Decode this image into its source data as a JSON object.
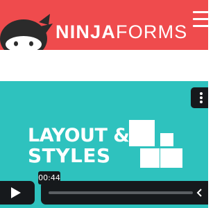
{
  "header": {
    "brand_bold": "NINJA",
    "brand_light": "FORMS",
    "mascot_icon": "ninja-mascot-icon",
    "menu_icon": "hamburger-menu-icon",
    "background_color": "#ef4b4d"
  },
  "video": {
    "background_color": "#2ec2be",
    "title_line_1": "LAYOUT &",
    "title_line_2": "STYLES",
    "graphic_icon": "layout-squares-icon",
    "more_icon": "more-vertical-icon"
  },
  "player": {
    "play_icon": "play-icon",
    "time_tooltip": "00:44",
    "rewind_icon": "rewind-chevron-icon",
    "controls_color": "#16191c"
  }
}
